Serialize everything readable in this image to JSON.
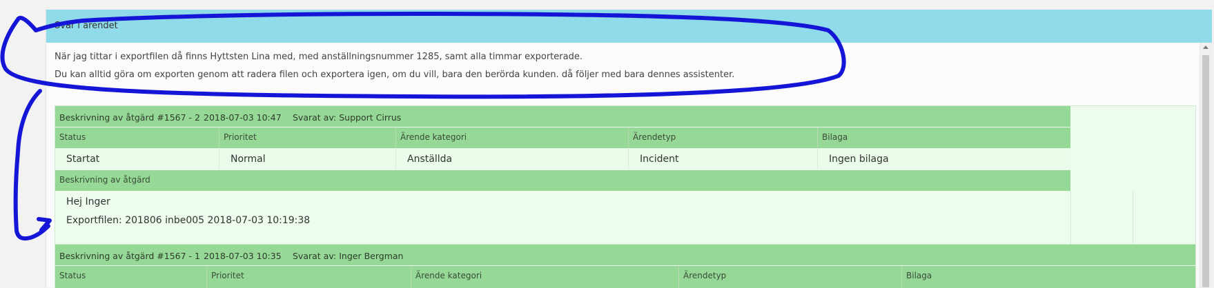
{
  "panel": {
    "title": "Svar i ärendet",
    "reply_lines": [
      "När jag tittar i exportfilen då finns Hyttsten Lina med, med anställningsnummer 1285, samt alla timmar exporterade.",
      "Du kan alltid göra om exporten genom att radera filen och exportera igen, om du vill, bara den berörda kunden. då följer med bara dennes assistenter."
    ]
  },
  "actions": [
    {
      "title": "Beskrivning av åtgärd #1567 - 2",
      "date": "2018-07-03 10:47",
      "answered_by": "Svarat av: Support Cirrus",
      "headers": [
        "Status",
        "Prioritet",
        "Ärende kategori",
        "Ärendetyp",
        "Bilaga"
      ],
      "values": [
        "Startat",
        "Normal",
        "Anställda",
        "Incident",
        "Ingen bilaga"
      ],
      "description_label": "Beskrivning av åtgärd",
      "description_lines": [
        "Hej Inger",
        "Exportfilen: 201806 inbe005 2018-07-03 10:19:38"
      ]
    },
    {
      "title": "Beskrivning av åtgärd #1567 - 1",
      "date": "2018-07-03 10:35",
      "answered_by": "Svarat av: Inger Bergman",
      "headers": [
        "Status",
        "Prioritet",
        "Ärende kategori",
        "Ärendetyp",
        "Bilaga"
      ]
    }
  ],
  "colors": {
    "header_bg": "#8fdbe9",
    "card_header_bg": "#96d996",
    "card_body_bg": "#eefcee",
    "annotation_stroke": "#1515d8"
  }
}
